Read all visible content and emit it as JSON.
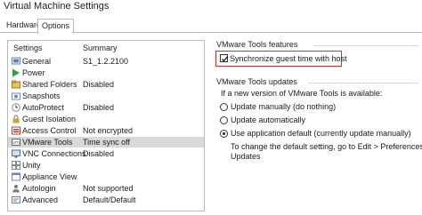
{
  "window": {
    "title": "Virtual Machine Settings"
  },
  "tabs": [
    {
      "label": "Hardware"
    },
    {
      "label": "Options"
    }
  ],
  "settings_list": {
    "col_settings": "Settings",
    "col_summary": "Summary",
    "items": [
      {
        "label": "General",
        "summary": "S1_1.2.2100",
        "icon": "general-icon",
        "color": "#5a7fbf"
      },
      {
        "label": "Power",
        "summary": "",
        "icon": "power-play-icon",
        "color": "#2e9e3e"
      },
      {
        "label": "Shared Folders",
        "summary": "Disabled",
        "icon": "shared-folders-icon",
        "color": "#6b7f99"
      },
      {
        "label": "Snapshots",
        "summary": "",
        "icon": "snapshots-icon",
        "color": "#6a8ab5"
      },
      {
        "label": "AutoProtect",
        "summary": "Disabled",
        "icon": "autoprotect-clock-icon",
        "color": "#8a8a8a"
      },
      {
        "label": "Guest Isolation",
        "summary": "",
        "icon": "guest-isolation-lock-icon",
        "color": "#8c8c8c"
      },
      {
        "label": "Access Control",
        "summary": "Not encrypted",
        "icon": "access-control-icon",
        "color": "#c0392b"
      },
      {
        "label": "VMware Tools",
        "summary": "Time sync off",
        "icon": "vmware-tools-icon",
        "color": "#5a6a7a"
      },
      {
        "label": "VNC Connections",
        "summary": "Disabled",
        "icon": "vnc-connections-icon",
        "color": "#4a6fa5"
      },
      {
        "label": "Unity",
        "summary": "",
        "icon": "unity-icon",
        "color": "#7a8a9a"
      },
      {
        "label": "Appliance View",
        "summary": "",
        "icon": "appliance-view-icon",
        "color": "#6a8ab5"
      },
      {
        "label": "Autologin",
        "summary": "Not supported",
        "icon": "autologin-icon",
        "color": "#7a7a7a"
      },
      {
        "label": "Advanced",
        "summary": "Default/Default",
        "icon": "advanced-icon",
        "color": "#6a7f99"
      }
    ],
    "selected_index": 7
  },
  "tools_features": {
    "title": "VMware Tools features",
    "sync_label": "Synchronize guest time with host",
    "sync_checked": true,
    "highlight_color": "#d32f2f"
  },
  "tools_updates": {
    "title": "VMware Tools updates",
    "prompt": "If a new version of VMware Tools is available:",
    "options": [
      {
        "label": "Update manually (do nothing)",
        "selected": false
      },
      {
        "label": "Update automatically",
        "selected": false
      },
      {
        "label": "Use application default (currently update manually)",
        "selected": true
      }
    ],
    "hint_line1": "To change the default setting, go to Edit > Preferences >",
    "hint_line2": "Updates"
  }
}
